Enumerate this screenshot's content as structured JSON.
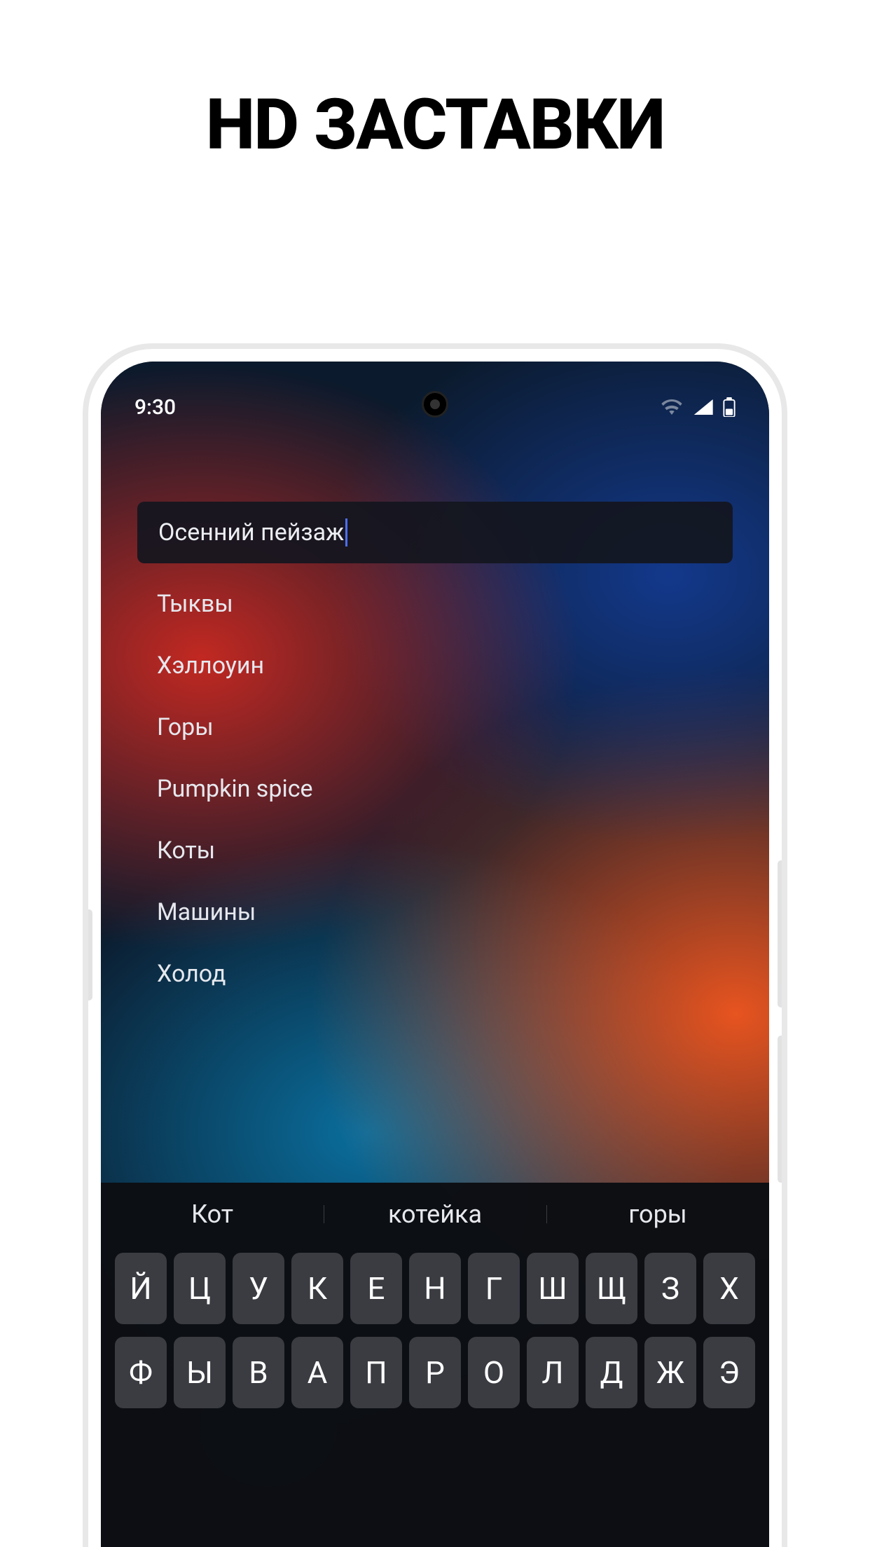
{
  "headline": "HD ЗАСТАВКИ",
  "status": {
    "time": "9:30"
  },
  "search": {
    "value": "Осенний пейзаж"
  },
  "suggestions": [
    "Тыквы",
    "Хэллоуин",
    "Горы",
    "Pumpkin spice",
    "Коты",
    "Машины",
    "Холод"
  ],
  "keyboard": {
    "predictions": [
      "Кот",
      "котейка",
      "горы"
    ],
    "rows": [
      [
        "Й",
        "Ц",
        "У",
        "К",
        "Е",
        "Н",
        "Г",
        "Ш",
        "Щ",
        "З",
        "Х"
      ],
      [
        "Ф",
        "Ы",
        "В",
        "А",
        "П",
        "Р",
        "О",
        "Л",
        "Д",
        "Ж",
        "Э"
      ]
    ]
  }
}
